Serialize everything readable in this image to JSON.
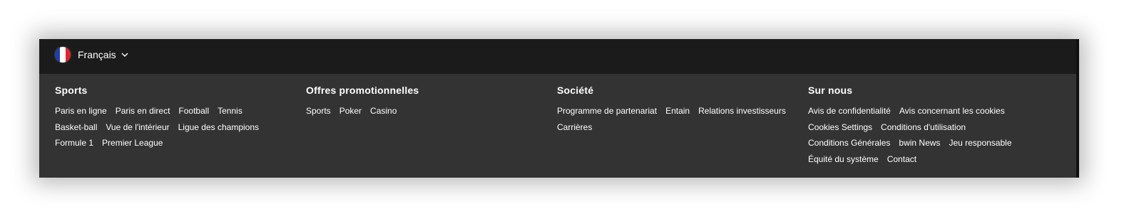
{
  "language": {
    "label": "Français",
    "flag_colors": [
      "#1f3fa6",
      "#ffffff",
      "#e1252f"
    ],
    "icons": {
      "flag": "france-flag-icon",
      "chevron": "chevron-down-icon"
    }
  },
  "colors": {
    "footer_bg": "#333333",
    "lang_bar_bg": "#1b1b1b",
    "text": "#ffffff"
  },
  "columns": [
    {
      "title": "Sports",
      "links": [
        "Paris en ligne",
        "Paris en direct",
        "Football",
        "Tennis",
        "Basket-ball",
        "Vue de l'intérieur",
        "Ligue des champions",
        "Formule 1",
        "Premier League"
      ]
    },
    {
      "title": "Offres promotionnelles",
      "links": [
        "Sports",
        "Poker",
        "Casino"
      ]
    },
    {
      "title": "Société",
      "links": [
        "Programme de partenariat",
        "Entain",
        "Relations investisseurs",
        "Carrières"
      ]
    },
    {
      "title": "Sur nous",
      "links": [
        "Avis de confidentialité",
        "Avis concernant les cookies",
        "Cookies Settings",
        "Conditions d'utilisation",
        "Conditions Générales",
        "bwin News",
        "Jeu responsable",
        "Équité du système",
        "Contact"
      ]
    }
  ]
}
